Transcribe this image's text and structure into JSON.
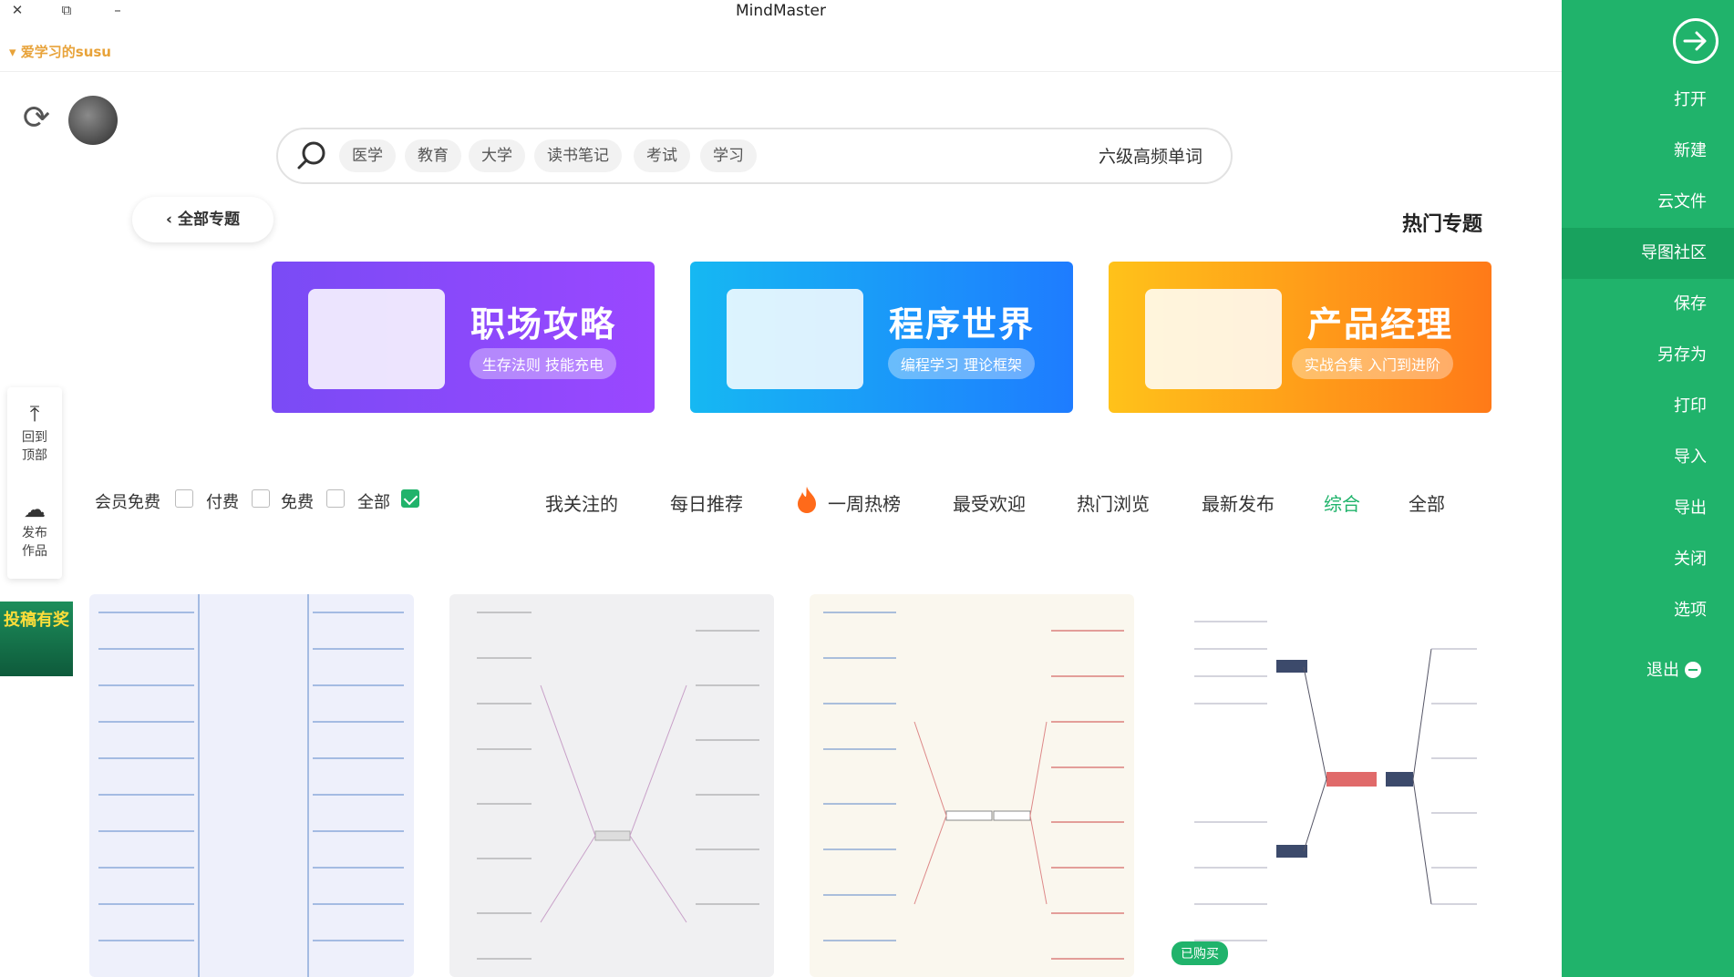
{
  "window": {
    "title": "MindMaster",
    "controls": [
      "✕",
      "⧉",
      "–"
    ]
  },
  "header": {
    "username": "爱学习的susu",
    "username_arrow": "▾"
  },
  "sidebar": {
    "open_icon": "arrow-right-circle-icon",
    "items": [
      {
        "label": "打开"
      },
      {
        "label": "新建"
      },
      {
        "label": "云文件"
      },
      {
        "label": "导图社区",
        "active": true
      },
      {
        "label": "保存"
      },
      {
        "label": "另存为"
      },
      {
        "label": "打印"
      },
      {
        "label": "导入"
      },
      {
        "label": "导出"
      },
      {
        "label": "关闭"
      },
      {
        "label": "选项"
      },
      {
        "label": "退出",
        "icon": "minus-circle-icon"
      }
    ],
    "bg_color": "#20b36b"
  },
  "search": {
    "query": "六级高频单词",
    "tags": [
      "学习",
      "考试",
      "读书笔记",
      "大学",
      "教育",
      "医学"
    ]
  },
  "hot_topics": {
    "title": "热门专题",
    "all_button": "全部专题",
    "banners": [
      {
        "title": "产品经理",
        "subtitle": "实战合集 入门到进阶"
      },
      {
        "title": "程序世界",
        "subtitle": "编程学习 理论框架"
      },
      {
        "title": "职场攻略",
        "subtitle": "生存法则 技能充电"
      }
    ]
  },
  "filters": {
    "tabs": [
      {
        "label": "全部"
      },
      {
        "label": "综合",
        "active": true
      },
      {
        "label": "最新发布"
      },
      {
        "label": "热门浏览"
      },
      {
        "label": "最受欢迎"
      },
      {
        "label": "一周热榜"
      },
      {
        "label": "每日推荐"
      },
      {
        "label": "我关注的"
      }
    ],
    "price": [
      {
        "label": "全部",
        "checked": true
      },
      {
        "label": "免费",
        "checked": false
      },
      {
        "label": "付费",
        "checked": false
      },
      {
        "label": "会员免费",
        "checked": false
      }
    ]
  },
  "float_tools": {
    "top_label": "回到顶部",
    "publish_label": "发布作品"
  },
  "promo": {
    "text": "投稿有奖"
  },
  "cards": {
    "badge": "已购买"
  }
}
